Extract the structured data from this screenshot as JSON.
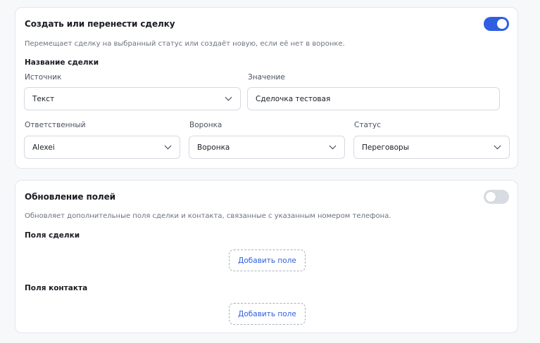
{
  "create_deal": {
    "title": "Создать или перенести сделку",
    "description": "Перемещает сделку на выбранный статус или создаёт новую, если её нет в воронке.",
    "enabled": true,
    "deal_name_section": "Название сделки",
    "source": {
      "label": "Источник",
      "value": "Текст"
    },
    "value_field": {
      "label": "Значение",
      "value": "Сделочка тестовая"
    },
    "responsible": {
      "label": "Ответственный",
      "value": "Alexei"
    },
    "pipeline": {
      "label": "Воронка",
      "value": "Воронка"
    },
    "status": {
      "label": "Статус",
      "value": "Переговоры"
    }
  },
  "update_fields": {
    "title": "Обновление полей",
    "description": "Обновляет дополнительные поля сделки и контакта, связанные с указанным номером телефона.",
    "enabled": false,
    "deal_fields_label": "Поля сделки",
    "contact_fields_label": "Поля контакта",
    "add_field_label": "Добавить поле"
  },
  "colors": {
    "accent": "#2f5fe0",
    "toggle_off": "#d7dbe2",
    "border": "#e3e6eb"
  }
}
